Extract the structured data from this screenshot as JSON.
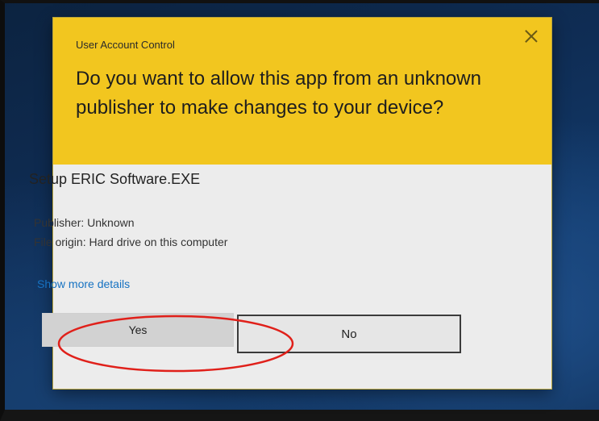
{
  "dialog": {
    "title": "User Account Control",
    "question": "Do you want to allow this app from an unknown publisher to make changes to your device?",
    "app_name": "Setup ERIC Software.EXE",
    "publisher": "Publisher: Unknown",
    "file_origin": "File origin: Hard drive on this computer",
    "details_link": "Show more details",
    "yes_label": "Yes",
    "no_label": "No",
    "close_icon": "close-icon"
  },
  "colors": {
    "header_yellow": "#f2c61f",
    "link_blue": "#1672c2",
    "highlight_red": "#e0201a"
  }
}
